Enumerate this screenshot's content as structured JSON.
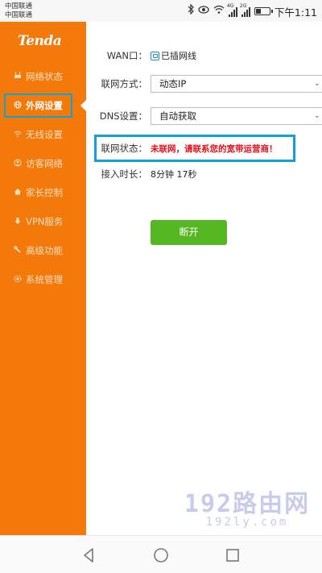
{
  "status_bar": {
    "carrier_1": "中国联通",
    "carrier_2": "中国联通",
    "time": "下午1:11",
    "signal_1_label": "4G",
    "signal_2_label": "2G"
  },
  "sidebar": {
    "logo": "Tenda",
    "items": [
      {
        "label": "网络状态",
        "icon": "router-icon"
      },
      {
        "label": "外网设置",
        "icon": "globe-icon",
        "active": true
      },
      {
        "label": "无线设置",
        "icon": "wifi-icon"
      },
      {
        "label": "访客网络",
        "icon": "guest-icon"
      },
      {
        "label": "家长控制",
        "icon": "home-icon"
      },
      {
        "label": "VPN服务",
        "icon": "vpn-icon"
      },
      {
        "label": "高级功能",
        "icon": "wrench-icon"
      },
      {
        "label": "系统管理",
        "icon": "gear-icon"
      }
    ]
  },
  "main": {
    "wan": {
      "label": "WAN口：",
      "value": "已插网线"
    },
    "connection_type": {
      "label": "联网方式：",
      "value": "动态IP"
    },
    "dns": {
      "label": "DNS设置：",
      "value": "自动获取"
    },
    "status": {
      "label": "联网状态：",
      "value": "未联网，请联系您的宽带运营商！"
    },
    "uptime": {
      "label": "接入时长：",
      "value": "8分钟 17秒"
    },
    "disconnect_button": "断开"
  },
  "watermark": {
    "main": "192路由网",
    "sub": "192ly.com"
  },
  "colors": {
    "sidebar": "#f2790a",
    "highlight": "#12a0d8",
    "button": "#55b822",
    "error": "#e0101a"
  }
}
